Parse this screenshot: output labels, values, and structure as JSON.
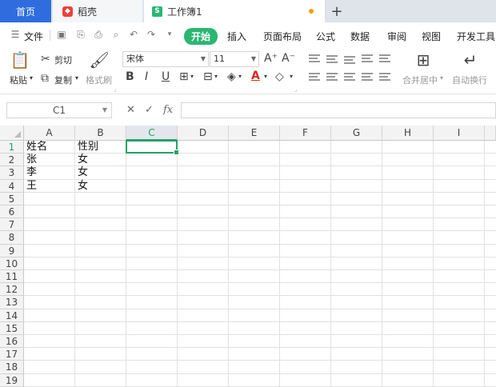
{
  "tabs": [
    {
      "label": "首页"
    },
    {
      "label": "稻壳"
    },
    {
      "label": "工作簿1"
    }
  ],
  "menu": {
    "file": "文件",
    "items": [
      "开始",
      "插入",
      "页面布局",
      "公式",
      "数据",
      "审阅",
      "视图",
      "开发工具"
    ]
  },
  "ribbon": {
    "paste": "粘贴",
    "cut": "剪切",
    "copy": "复制",
    "format_painter": "格式刷",
    "font_name": "宋体",
    "font_size": "11",
    "merge": "合并居中",
    "wrap": "自动换行"
  },
  "formula": {
    "cell_ref": "C1",
    "fx": "fx",
    "value": ""
  },
  "grid": {
    "columns": [
      "A",
      "B",
      "C",
      "D",
      "E",
      "F",
      "G",
      "H",
      "I"
    ],
    "active_column": "C",
    "rows": [
      "1",
      "2",
      "3",
      "4",
      "5",
      "6",
      "7",
      "8",
      "9",
      "10",
      "11",
      "12",
      "13",
      "14",
      "15",
      "16",
      "17",
      "18",
      "19"
    ],
    "cells": {
      "A1": "姓名",
      "B1": "性别",
      "A2": "张",
      "B2": "女",
      "A3": "李",
      "B3": "女",
      "A4": "王",
      "B4": "女"
    }
  },
  "colors": {
    "accent_green": "#21a366",
    "home_tab_blue": "#2f6ddf",
    "start_button_green": "#2bb673"
  }
}
